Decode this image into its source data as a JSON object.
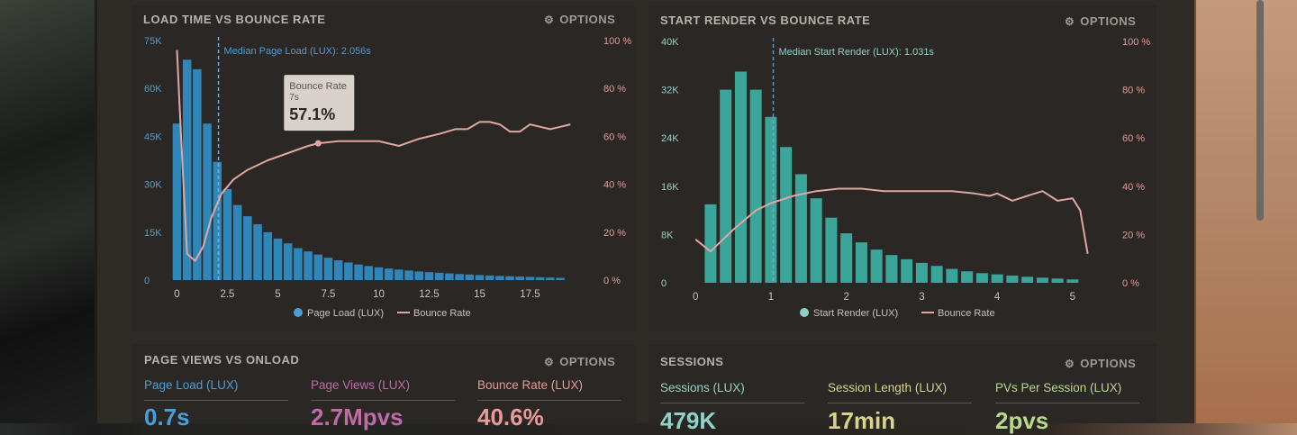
{
  "colors": {
    "bar_blue": "#2f86b8",
    "bar_teal": "#3aa69a",
    "bounce_line": "#e0a7a2",
    "axis_left": "#4a9fd6",
    "axis_right": "#e79a97",
    "axis_left_right_panel": "#8fd2c8"
  },
  "panels": {
    "load": {
      "title": "LOAD TIME VS BOUNCE RATE",
      "options": "OPTIONS"
    },
    "render": {
      "title": "START RENDER VS BOUNCE RATE",
      "options": "OPTIONS"
    },
    "pageviews": {
      "title": "PAGE VIEWS VS ONLOAD",
      "options": "OPTIONS"
    },
    "sessions": {
      "title": "SESSIONS",
      "options": "OPTIONS"
    }
  },
  "stats": {
    "pageviews": [
      {
        "label": "Page Load (LUX)",
        "value": "0.7s",
        "color": "#4a9fd6"
      },
      {
        "label": "Page Views (LUX)",
        "value": "2.7Mpvs",
        "color": "#c06aa8"
      },
      {
        "label": "Bounce Rate (LUX)",
        "value": "40.6%",
        "color": "#e79a97"
      }
    ],
    "sessions": [
      {
        "label": "Sessions (LUX)",
        "value": "479K",
        "color": "#8fd2c8"
      },
      {
        "label": "Session Length (LUX)",
        "value": "17min",
        "color": "#d8d28a"
      },
      {
        "label": "PVs Per Session (LUX)",
        "value": "2pvs",
        "color": "#b8d88a"
      }
    ]
  },
  "chart_data": [
    {
      "type": "bar",
      "title": "LOAD TIME VS BOUNCE RATE",
      "x_ticks": [
        "0",
        "2.5",
        "5",
        "7.5",
        "10",
        "12.5",
        "15",
        "17.5"
      ],
      "x_tick_values": [
        0,
        2.5,
        5,
        7.5,
        10,
        12.5,
        15,
        17.5
      ],
      "xlim": [
        -0.2,
        19.8
      ],
      "y_left_ticks": [
        "0",
        "15K",
        "30K",
        "45K",
        "60K",
        "75K"
      ],
      "y_left_range": [
        0,
        75000
      ],
      "y_right_ticks": [
        "0 %",
        "20 %",
        "40 %",
        "60 %",
        "80 %",
        "100 %"
      ],
      "y_right_range": [
        0,
        100
      ],
      "annotation": {
        "text": "Median Page Load (LUX): 2.056s",
        "x": 2.056
      },
      "tooltip": {
        "title": "Bounce Rate",
        "sub": "7s",
        "value": "57.1%",
        "x": 7,
        "y": 57.1
      },
      "legend": [
        "Page Load (LUX)",
        "Bounce Rate"
      ],
      "series": [
        {
          "name": "Page Load (LUX)",
          "kind": "bar",
          "x": [
            0,
            0.5,
            1,
            1.5,
            2,
            2.5,
            3,
            3.5,
            4,
            4.5,
            5,
            5.5,
            6,
            6.5,
            7,
            7.5,
            8,
            8.5,
            9,
            9.5,
            10,
            10.5,
            11,
            11.5,
            12,
            12.5,
            13,
            13.5,
            14,
            14.5,
            15,
            15.5,
            16,
            16.5,
            17,
            17.5,
            18,
            18.5,
            19
          ],
          "values": [
            49000,
            69000,
            66000,
            49000,
            37000,
            28500,
            23500,
            20000,
            17500,
            15000,
            13000,
            11500,
            10000,
            9000,
            8000,
            7000,
            6200,
            5500,
            4900,
            4400,
            4000,
            3600,
            3300,
            3000,
            2700,
            2500,
            2300,
            2100,
            1900,
            1750,
            1600,
            1450,
            1300,
            1200,
            1100,
            1000,
            900,
            800,
            700
          ]
        },
        {
          "name": "Bounce Rate",
          "kind": "line",
          "x": [
            0,
            0.2,
            0.5,
            0.9,
            1.3,
            1.7,
            2.2,
            2.8,
            3.5,
            4.5,
            5.5,
            6.5,
            7,
            8,
            9,
            10,
            10.5,
            11,
            12,
            13,
            13.8,
            14.4,
            15,
            15.5,
            16,
            16.5,
            17,
            17.5,
            18,
            18.5,
            19,
            19.5
          ],
          "values": [
            96,
            60,
            11,
            8,
            14,
            26,
            36,
            42,
            46,
            50,
            53,
            56,
            57.1,
            58,
            58,
            58,
            57,
            56,
            59,
            61,
            63,
            63,
            66,
            66,
            65,
            62,
            62,
            65,
            64,
            63,
            64,
            65
          ]
        }
      ]
    },
    {
      "type": "bar",
      "title": "START RENDER VS BOUNCE RATE",
      "x_ticks": [
        "0",
        "1",
        "2",
        "3",
        "4",
        "5"
      ],
      "x_tick_values": [
        0,
        1,
        2,
        3,
        4,
        5
      ],
      "xlim": [
        -0.05,
        5.3
      ],
      "y_left_ticks": [
        "0",
        "8K",
        "16K",
        "24K",
        "32K",
        "40K"
      ],
      "y_left_range": [
        0,
        40000
      ],
      "y_right_ticks": [
        "0 %",
        "20 %",
        "40 %",
        "60 %",
        "80 %",
        "100 %"
      ],
      "y_right_range": [
        0,
        100
      ],
      "annotation": {
        "text": "Median Start Render (LUX): 1.031s",
        "x": 1.031
      },
      "legend": [
        "Start Render (LUX)",
        "Bounce Rate"
      ],
      "series": [
        {
          "name": "Start Render (LUX)",
          "kind": "bar",
          "x": [
            0.2,
            0.4,
            0.6,
            0.8,
            1.0,
            1.2,
            1.4,
            1.6,
            1.8,
            2.0,
            2.2,
            2.4,
            2.6,
            2.8,
            3.0,
            3.2,
            3.4,
            3.6,
            3.8,
            4.0,
            4.2,
            4.4,
            4.6,
            4.8,
            5.0
          ],
          "values": [
            13000,
            32000,
            35000,
            32000,
            27500,
            22500,
            18000,
            14000,
            10800,
            8200,
            6700,
            5500,
            4600,
            3900,
            3300,
            2800,
            2300,
            1900,
            1600,
            1400,
            1200,
            1000,
            850,
            700,
            550
          ]
        },
        {
          "name": "Bounce Rate",
          "kind": "line",
          "x": [
            0,
            0.2,
            0.5,
            0.8,
            1.0,
            1.3,
            1.6,
            1.9,
            2.2,
            2.5,
            2.8,
            3.1,
            3.4,
            3.7,
            3.9,
            4.0,
            4.2,
            4.4,
            4.6,
            4.8,
            5.0,
            5.1,
            5.2
          ],
          "values": [
            18,
            13,
            22,
            30,
            33,
            36,
            38,
            39,
            39,
            38,
            38,
            38,
            38,
            37,
            36,
            37,
            34,
            36,
            38,
            34,
            35,
            30,
            12
          ]
        }
      ]
    }
  ]
}
